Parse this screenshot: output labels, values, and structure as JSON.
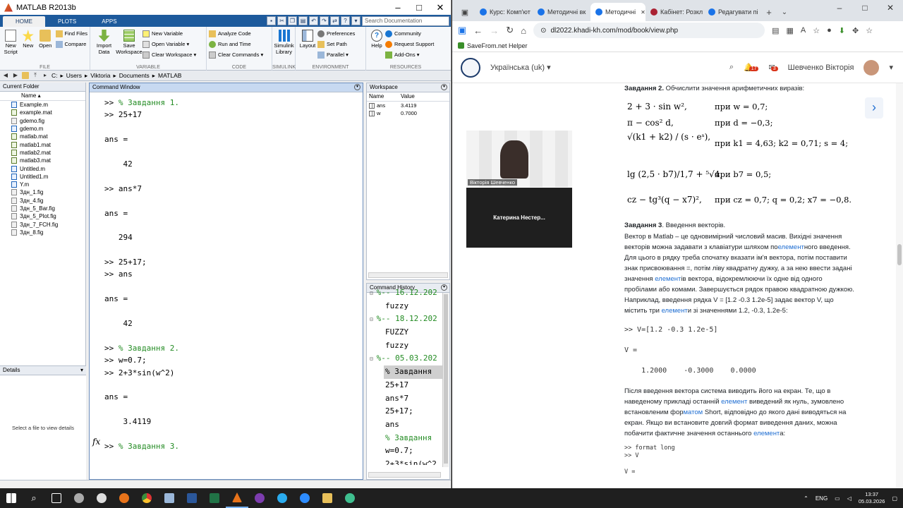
{
  "matlab": {
    "title": "MATLAB R2013b",
    "tabs": [
      "HOME",
      "PLOTS",
      "APPS"
    ],
    "search_placeholder": "Search Documentation",
    "ribbon": {
      "file": {
        "group": "FILE",
        "new_script": "New\nScript",
        "new": "New",
        "open": "Open",
        "find_files": "Find Files",
        "compare": "Compare"
      },
      "variable": {
        "group": "VARIABLE",
        "import": "Import\nData",
        "save": "Save\nWorkspace",
        "new_var": "New Variable",
        "open_var": "Open Variable",
        "clear_ws": "Clear Workspace"
      },
      "code": {
        "group": "CODE",
        "analyze": "Analyze Code",
        "run_time": "Run and Time",
        "clear_cmd": "Clear Commands"
      },
      "simulink": {
        "group": "SIMULINK",
        "lib": "Simulink\nLibrary"
      },
      "environment": {
        "group": "ENVIRONMENT",
        "layout": "Layout",
        "prefs": "Preferences",
        "set_path": "Set Path",
        "parallel": "Parallel"
      },
      "resources": {
        "group": "RESOURCES",
        "help": "Help",
        "community": "Community",
        "support": "Request Support",
        "addons": "Add-Ons"
      }
    },
    "address": [
      "C:",
      "Users",
      "Viktoria",
      "Documents",
      "MATLAB"
    ],
    "current_folder": {
      "title": "Current Folder",
      "col": "Name",
      "files": [
        {
          "name": "Example.m",
          "type": "m"
        },
        {
          "name": "example.mat",
          "type": "mat"
        },
        {
          "name": "gdemo.fig",
          "type": "fig"
        },
        {
          "name": "gdemo.m",
          "type": "m"
        },
        {
          "name": "matlab.mat",
          "type": "mat"
        },
        {
          "name": "matlab1.mat",
          "type": "mat"
        },
        {
          "name": "matlab2.mat",
          "type": "mat"
        },
        {
          "name": "matlab3.mat",
          "type": "mat"
        },
        {
          "name": "Untitled.m",
          "type": "m"
        },
        {
          "name": "Untitled1.m",
          "type": "m"
        },
        {
          "name": "Y.m",
          "type": "m"
        },
        {
          "name": "Здн_1.fig",
          "type": "fig"
        },
        {
          "name": "Здн_4.fig",
          "type": "fig"
        },
        {
          "name": "Здн_5_Bar.fig",
          "type": "fig"
        },
        {
          "name": "Здн_5_Plot.fig",
          "type": "fig"
        },
        {
          "name": "Здн_7_FCH.fig",
          "type": "fig"
        },
        {
          "name": "Здн_8.fig",
          "type": "fig"
        }
      ]
    },
    "details": {
      "title": "Details",
      "message": "Select a file to view details"
    },
    "command_window": {
      "title": "Command Window",
      "lines": [
        {
          "t": ">> ",
          "c": "% Завдання 1."
        },
        {
          "t": ">> 25+17",
          "c": ""
        },
        {
          "t": "",
          "c": ""
        },
        {
          "t": "ans =",
          "c": ""
        },
        {
          "t": "",
          "c": ""
        },
        {
          "t": "    42",
          "c": ""
        },
        {
          "t": "",
          "c": ""
        },
        {
          "t": ">> ans*7",
          "c": ""
        },
        {
          "t": "",
          "c": ""
        },
        {
          "t": "ans =",
          "c": ""
        },
        {
          "t": "",
          "c": ""
        },
        {
          "t": "   294",
          "c": ""
        },
        {
          "t": "",
          "c": ""
        },
        {
          "t": ">> 25+17;",
          "c": ""
        },
        {
          "t": ">> ans",
          "c": ""
        },
        {
          "t": "",
          "c": ""
        },
        {
          "t": "ans =",
          "c": ""
        },
        {
          "t": "",
          "c": ""
        },
        {
          "t": "    42",
          "c": ""
        },
        {
          "t": "",
          "c": ""
        },
        {
          "t": ">> ",
          "c": "% Завдання 2."
        },
        {
          "t": ">> w=0.7;",
          "c": ""
        },
        {
          "t": ">> 2+3*sin(w^2)",
          "c": ""
        },
        {
          "t": "",
          "c": ""
        },
        {
          "t": "ans =",
          "c": ""
        },
        {
          "t": "",
          "c": ""
        },
        {
          "t": "    3.4119",
          "c": ""
        },
        {
          "t": "",
          "c": ""
        },
        {
          "t": ">> ",
          "c": "% Завдання 3."
        }
      ],
      "fx": "fx"
    },
    "workspace": {
      "title": "Workspace",
      "cols": [
        "Name",
        "Value"
      ],
      "vars": [
        {
          "name": "ans",
          "value": "3.4119"
        },
        {
          "name": "w",
          "value": "0.7000"
        }
      ]
    },
    "history": {
      "title": "Command History",
      "items": [
        {
          "t": "%-- 16.12.202",
          "k": "date"
        },
        {
          "t": "fuzzy",
          "k": ""
        },
        {
          "t": "%-- 18.12.202",
          "k": "date"
        },
        {
          "t": "FUZZY",
          "k": ""
        },
        {
          "t": "fuzzy",
          "k": ""
        },
        {
          "t": "%-- 05.03.202",
          "k": "date"
        },
        {
          "t": "% Завдання",
          "k": "sel"
        },
        {
          "t": "25+17",
          "k": ""
        },
        {
          "t": "ans*7",
          "k": ""
        },
        {
          "t": "25+17;",
          "k": ""
        },
        {
          "t": "ans",
          "k": ""
        },
        {
          "t": "% Завдання",
          "k": "cm"
        },
        {
          "t": "w=0.7;",
          "k": ""
        },
        {
          "t": "2+3*sin(w^2",
          "k": ""
        }
      ]
    }
  },
  "browser": {
    "tabs": [
      {
        "label": "Курс: Комп'ют",
        "active": false
      },
      {
        "label": "Методичні вк",
        "active": false
      },
      {
        "label": "Методичні",
        "active": true
      },
      {
        "label": "Кабінет: Розкл",
        "active": false
      },
      {
        "label": "Редагувати пі",
        "active": false
      }
    ],
    "url": "dl2022.khadi-kh.com/mod/book/view.php",
    "bookmark": "SaveFrom.net Helper",
    "lang": "Українська (uk)",
    "notif_count": "17",
    "msg_count": "3",
    "user": "Шевченко Вікторія",
    "video_label": "Вікторія Шевченко",
    "video2_label": "Катерина  Нестер...",
    "task2_head": "Завдання 2.",
    "task2_text": " Обчислити значення арифметичних виразів:",
    "formulas": [
      {
        "expr": "2 + 3 · sin w²,",
        "cond": "при  w = 0,7;"
      },
      {
        "expr": "π − cos² d,",
        "cond": "при  d = −0,3;"
      },
      {
        "expr": "√(k1 + k2) / (s · eˢ),",
        "cond": "при  k1 = 4,63;  k2 = 0,71;  s = 4;"
      },
      {
        "expr": "lg (2,5 · b7)/1,7 + ⁵√4,",
        "cond": "при  b7 = 0,5;"
      },
      {
        "expr": "cz − tg³(q − x7)²,",
        "cond": "при  cz = 0,7;  q = 0,2;  x7 = −0,8."
      }
    ],
    "task3_head": "Завдання 3",
    "task3_title": ". Введення векторів.",
    "para1": "Вектор в Matlab – це одновимірний числовий масив. Вихідні значення векторів можна задавати з клавіатури шляхом по",
    "para1_link": "елемент",
    "para1_b": "ного введення. Для цього в рядку треба спочатку вказати ім'я вектора, потім поставити знак присвоювання =, потім ліву квадратну дужку, а за нею ввести задані значення ",
    "para1_link2": "елемент",
    "para1_c": "ів вектора, відокремлюючи їх одне від одного пробілами або комами. Завершується рядок правою квадратною дужкою. Наприклад, введення рядка V = [1.2 -0.3 1.2e-5] задає вектор V, що містить три ",
    "para1_link3": "елемент",
    "para1_d": "и зі значеннями 1.2, -0.3, 1.2e-5:",
    "code1": ">> V=[1.2 -0.3 1.2e-5]",
    "code2": "V =",
    "code3": "    1.2000    -0.3000    0.0000",
    "para2": "Після введення вектора система виводить його на екран. Те, що в наведеному прикладі останній ",
    "para2_link": "елемент",
    "para2_b": " виведений як нуль, зумовлено встановленим фор",
    "para2_link2": "матом",
    "para2_c": " Short, відповідно до якого дані виводяться на екран. Якщо ви встановите довгий формат виведення даних, можна побачити фактичне значення останнього ",
    "para2_link3": "елемент",
    "para2_d": "а:",
    "code4": ">> format long",
    "code5": ">> V",
    "code6": "V ="
  },
  "taskbar": {
    "lang": "ENG",
    "time": "13:37",
    "date": "05.03.2026"
  },
  "chart_data": {
    "type": "table",
    "title": "Workspace",
    "columns": [
      "Name",
      "Value"
    ],
    "rows": [
      [
        "ans",
        "3.4119"
      ],
      [
        "w",
        "0.7000"
      ]
    ]
  }
}
